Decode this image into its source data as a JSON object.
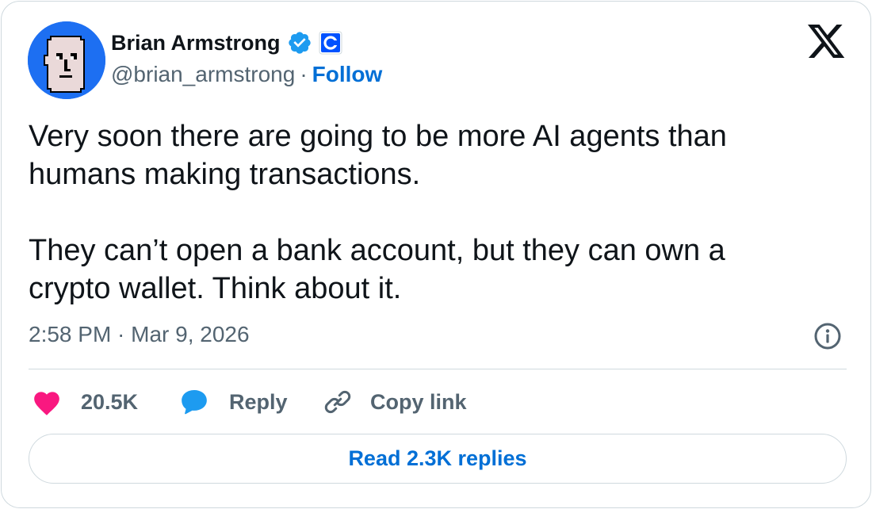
{
  "author": {
    "display_name": "Brian Armstrong",
    "handle": "@brian_armstrong",
    "separator": "·",
    "follow_label": "Follow",
    "verified_icon": "verified-badge-icon",
    "affiliate_icon": "coinbase-affiliate-icon"
  },
  "tweet": {
    "text": "Very soon there are going to be more AI agents than\nhumans making transactions.\n\nThey can’t open a bank account, but they can own a\ncrypto wallet. Think about it.",
    "timestamp": "2:58 PM · Mar 9, 2026"
  },
  "actions": {
    "like_count": "20.5K",
    "reply_label": "Reply",
    "copy_link_label": "Copy link",
    "read_replies_label": "Read 2.3K replies"
  },
  "colors": {
    "accent": "#006fd6",
    "verified": "#1d9bf0",
    "like": "#f91880",
    "reply": "#1d9bf0",
    "secondary_text": "#536471",
    "border": "#cfd9de"
  }
}
